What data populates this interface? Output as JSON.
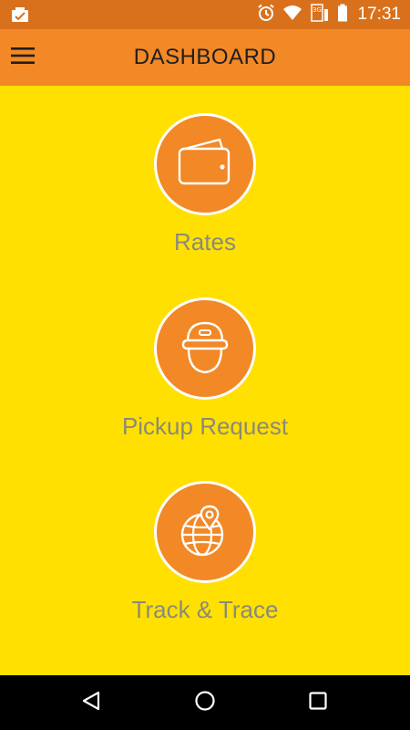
{
  "status_bar": {
    "time": "17:31",
    "network_label": "3G"
  },
  "app_bar": {
    "title": "DASHBOARD"
  },
  "tiles": [
    {
      "label": "Rates",
      "icon": "wallet-icon"
    },
    {
      "label": "Pickup Request",
      "icon": "delivery-person-icon"
    },
    {
      "label": "Track & Trace",
      "icon": "globe-location-icon"
    }
  ],
  "colors": {
    "status_bar": "#d9711c",
    "app_bar": "#f28826",
    "background": "#ffe000",
    "tile_circle": "#f28826",
    "label_text": "#8a8a7a",
    "nav_bar": "#000000"
  }
}
